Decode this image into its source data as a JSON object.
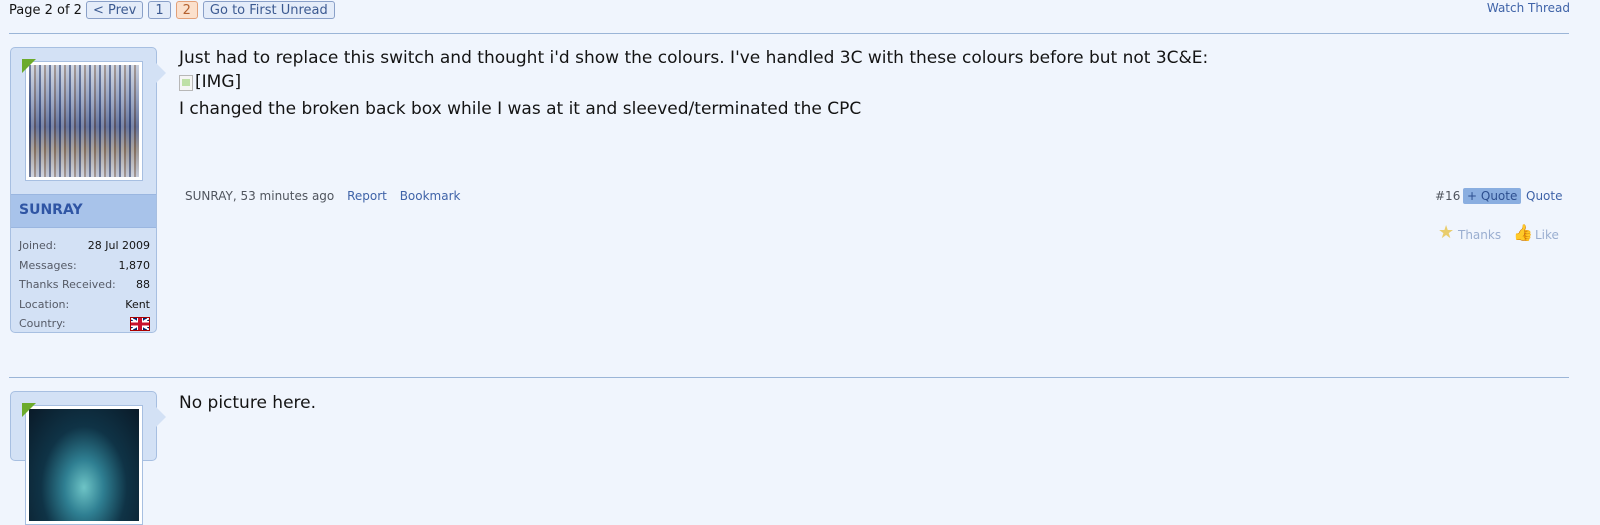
{
  "pagination": {
    "label": "Page 2 of 2",
    "prev": "< Prev",
    "pages": [
      "1",
      "2"
    ],
    "current_page": "2",
    "first_unread": "Go to First Unread"
  },
  "watch_thread": "Watch Thread",
  "post1": {
    "username": "SUNRAY",
    "stats": [
      {
        "key": "Joined:",
        "value": "28 Jul 2009"
      },
      {
        "key": "Messages:",
        "value": "1,870"
      },
      {
        "key": "Thanks Received:",
        "value": "88"
      },
      {
        "key": "Location:",
        "value": "Kent"
      },
      {
        "key": "Country:",
        "value": ""
      }
    ],
    "country_flag": "uk-flag-icon",
    "body_line1": "Just had to replace this switch and thought i'd show the colours. I've handled 3C with these colours before but not 3C&E:",
    "image_alt": "[IMG]",
    "body_line2": "I changed the broken back box while I was at it and sleeved/terminated the CPC",
    "meta_author_time": "SUNRAY, 53 minutes ago",
    "report": "Report",
    "bookmark": "Bookmark",
    "post_number": "#16",
    "multi_quote": "+ Quote",
    "quote": "Quote",
    "thanks": "Thanks",
    "like": "Like"
  },
  "post2": {
    "body": "No picture here."
  },
  "colors": {
    "background": "#f0f5fd",
    "link": "#3f63a8",
    "username": "#2f55a4",
    "user_panel": "#d3e1f5"
  }
}
